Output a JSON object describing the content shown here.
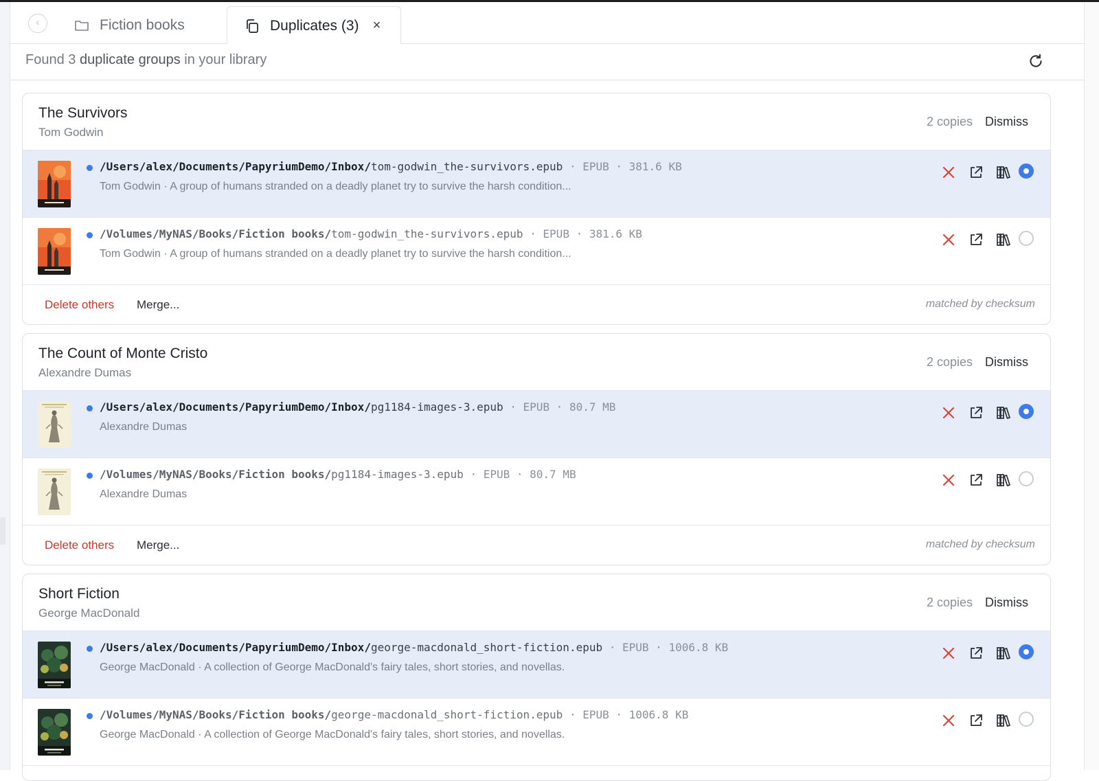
{
  "tabs": {
    "fiction": {
      "label": "Fiction books",
      "icon": "folder-icon"
    },
    "duplicates": {
      "label": "Duplicates (3)",
      "icon": "copy-icon",
      "close": "×"
    }
  },
  "summary": {
    "prefix": "Found 3 ",
    "bold": "duplicate groups",
    "suffix": " in your library"
  },
  "groups": [
    {
      "title": "The Survivors",
      "author": "Tom Godwin",
      "copies": "2 copies",
      "dismiss": "Dismiss",
      "delete_others": "Delete others",
      "merge": "Merge...",
      "matched": "matched by checksum",
      "rows": [
        {
          "dir": "/Users/alex/Documents/PapyriumDemo/Inbox/",
          "file": "tom-godwin_the-survivors.epub",
          "meta": " · EPUB · 381.6 KB",
          "desc": "Tom Godwin · A group of humans stranded on a deadly planet try to survive the harsh condition...",
          "selected": true
        },
        {
          "dir": "/Volumes/MyNAS/Books/Fiction books/",
          "file": "tom-godwin_the-survivors.epub",
          "meta": " · EPUB · 381.6 KB",
          "desc": "Tom Godwin · A group of humans stranded on a deadly planet try to survive the harsh condition...",
          "selected": false
        }
      ]
    },
    {
      "title": "The Count of Monte Cristo",
      "author": "Alexandre Dumas",
      "copies": "2 copies",
      "dismiss": "Dismiss",
      "delete_others": "Delete others",
      "merge": "Merge...",
      "matched": "matched by checksum",
      "rows": [
        {
          "dir": "/Users/alex/Documents/PapyriumDemo/Inbox/",
          "file": "pg1184-images-3.epub",
          "meta": " · EPUB · 80.7 MB",
          "desc": "Alexandre Dumas",
          "selected": true
        },
        {
          "dir": "/Volumes/MyNAS/Books/Fiction books/",
          "file": "pg1184-images-3.epub",
          "meta": " · EPUB · 80.7 MB",
          "desc": "Alexandre Dumas",
          "selected": false
        }
      ]
    },
    {
      "title": "Short Fiction",
      "author": "George MacDonald",
      "copies": "2 copies",
      "dismiss": "Dismiss",
      "rows": [
        {
          "dir": "/Users/alex/Documents/PapyriumDemo/Inbox/",
          "file": "george-macdonald_short-fiction.epub",
          "meta": " · EPUB · 1006.8 KB",
          "desc": "George MacDonald · A collection of George MacDonald's fairy tales, short stories, and novellas.",
          "selected": true
        },
        {
          "dir": "/Volumes/MyNAS/Books/Fiction books/",
          "file": "george-macdonald_short-fiction.epub",
          "meta": " · EPUB · 1006.8 KB",
          "desc": "George MacDonald · A collection of George MacDonald's fairy tales, short stories, and novellas.",
          "selected": false
        }
      ]
    }
  ],
  "colors": {
    "accent": "#3d7be8",
    "danger": "#c8372d",
    "selected_row": "#e7edf8"
  }
}
